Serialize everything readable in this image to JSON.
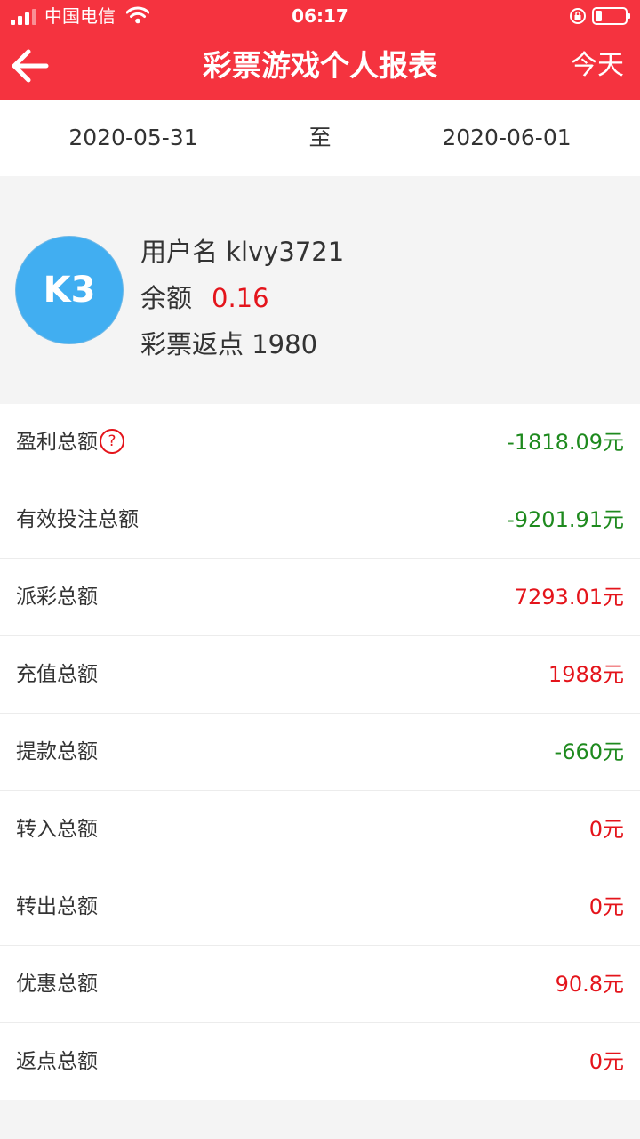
{
  "status_bar": {
    "carrier": "中国电信",
    "time": "06:17",
    "icons": [
      "signal-icon",
      "wifi-icon",
      "orientation-lock-icon",
      "battery-icon"
    ]
  },
  "header": {
    "title": "彩票游戏个人报表",
    "today_label": "今天",
    "back_icon": "arrow-left-icon",
    "background_color": "#f5333f"
  },
  "date_range": {
    "start": "2020-05-31",
    "separator": "至",
    "end": "2020-06-01"
  },
  "profile": {
    "avatar_text": "K3",
    "avatar_color": "#41aef1",
    "username_label": "用户名",
    "username": "klvy3721",
    "balance_label": "余额",
    "balance": "0.16",
    "rebate_label": "彩票返点",
    "rebate": "1980"
  },
  "stats": [
    {
      "label": "盈利总额",
      "value": "-1818.09元",
      "help": "?"
    },
    {
      "label": "有效投注总额",
      "value": "-9201.91元"
    },
    {
      "label": "派彩总额",
      "value": "7293.01元"
    },
    {
      "label": "充值总额",
      "value": "1988元"
    },
    {
      "label": "提款总额",
      "value": "-660元"
    },
    {
      "label": "转入总额",
      "value": "0元"
    },
    {
      "label": "转出总额",
      "value": "0元"
    },
    {
      "label": "优惠总额",
      "value": "90.8元"
    },
    {
      "label": "返点总额",
      "value": "0元"
    }
  ],
  "colors": {
    "positive": "#e4141b",
    "negative": "#1e8a1e"
  }
}
